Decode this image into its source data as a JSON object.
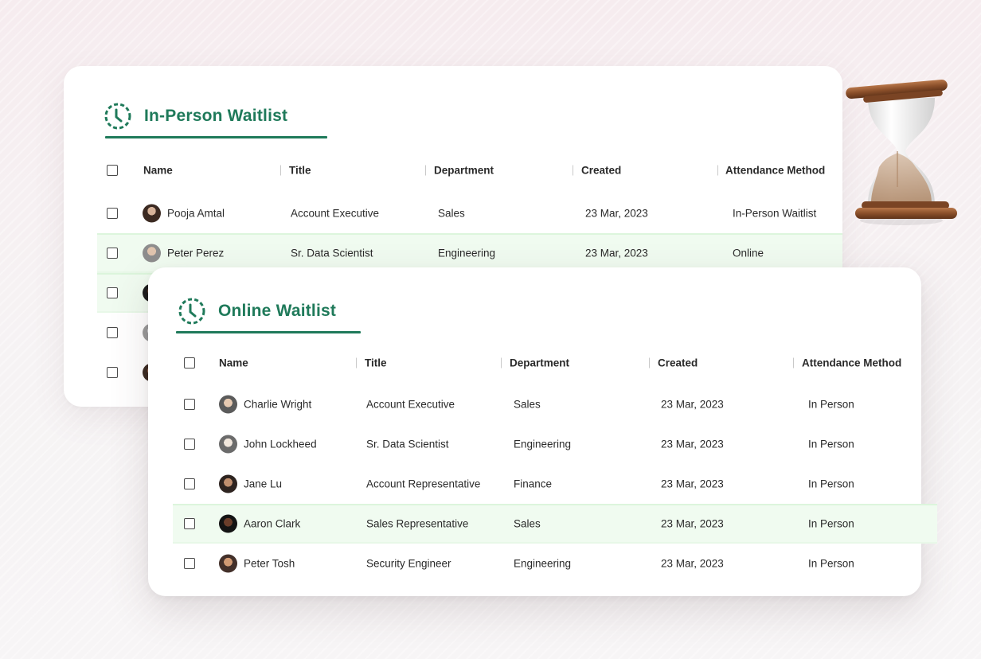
{
  "in_person": {
    "title": "In-Person Waitlist",
    "icon": "clock-icon",
    "columns": [
      "Name",
      "Title",
      "Department",
      "Created",
      "Attendance Method"
    ],
    "rows": [
      {
        "name": "Pooja Amtal",
        "title": "Account Executive",
        "department": "Sales",
        "created": "23 Mar, 2023",
        "method": "In-Person Waitlist"
      },
      {
        "name": "Peter Perez",
        "title": "Sr. Data Scientist",
        "department": "Engineering",
        "created": "23 Mar, 2023",
        "method": "Online"
      },
      {
        "name": "",
        "title": "",
        "department": "",
        "created": "",
        "method": ""
      },
      {
        "name": "",
        "title": "",
        "department": "",
        "created": "",
        "method": ""
      },
      {
        "name": "",
        "title": "",
        "department": "",
        "created": "",
        "method": ""
      }
    ]
  },
  "online": {
    "title": "Online Waitlist",
    "icon": "clock-icon",
    "columns": [
      "Name",
      "Title",
      "Department",
      "Created",
      "Attendance Method"
    ],
    "rows": [
      {
        "name": "Charlie Wright",
        "title": "Account Executive",
        "department": "Sales",
        "created": "23 Mar, 2023",
        "method": "In Person"
      },
      {
        "name": "John Lockheed",
        "title": "Sr. Data Scientist",
        "department": "Engineering",
        "created": "23 Mar, 2023",
        "method": "In Person"
      },
      {
        "name": "Jane Lu",
        "title": "Account Representative",
        "department": "Finance",
        "created": "23 Mar, 2023",
        "method": "In Person"
      },
      {
        "name": "Aaron Clark",
        "title": "Sales Representative",
        "department": "Sales",
        "created": "23 Mar, 2023",
        "method": "In Person"
      },
      {
        "name": "Peter Tosh",
        "title": "Security Engineer",
        "department": "Engineering",
        "created": "23 Mar, 2023",
        "method": "In Person"
      }
    ]
  },
  "colors": {
    "accent": "#1f7a5a",
    "row_highlight": "#f0fbf0"
  },
  "decoration": {
    "icon": "hourglass-icon"
  }
}
